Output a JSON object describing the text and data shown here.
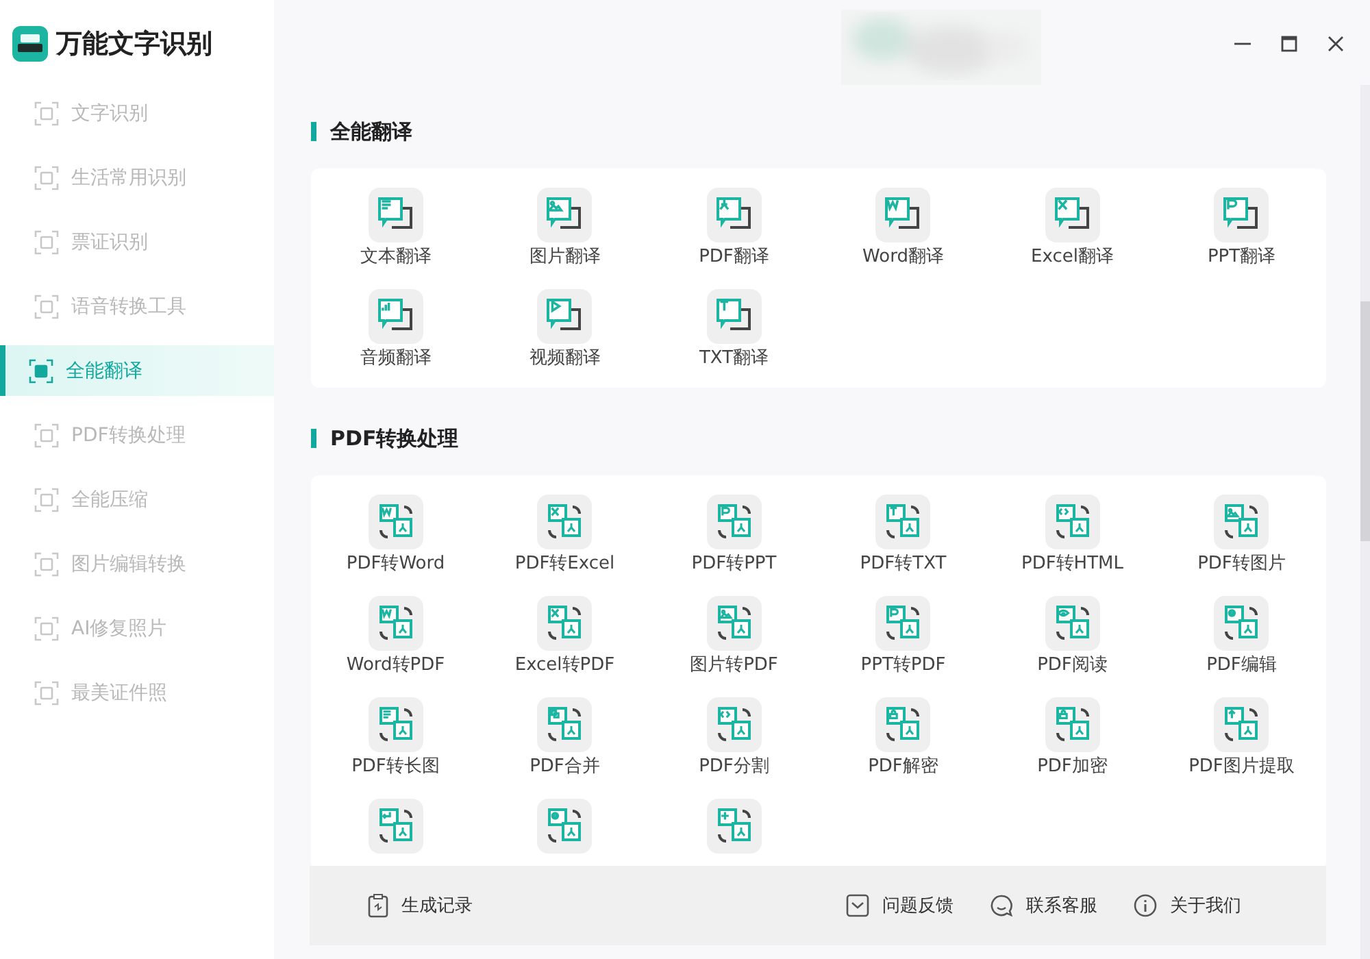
{
  "window": {
    "title": "万能文字识别"
  },
  "sidebar": {
    "items": [
      {
        "label": "文字识别",
        "selected": false
      },
      {
        "label": "生活常用识别",
        "selected": false
      },
      {
        "label": "票证识别",
        "selected": false
      },
      {
        "label": "语音转换工具",
        "selected": false
      },
      {
        "label": "全能翻译",
        "selected": true
      },
      {
        "label": "PDF转换处理",
        "selected": false
      },
      {
        "label": "全能压缩",
        "selected": false
      },
      {
        "label": "图片编辑转换",
        "selected": false
      },
      {
        "label": "AI修复照片",
        "selected": false
      },
      {
        "label": "最美证件照",
        "selected": false
      }
    ]
  },
  "sections": [
    {
      "title": "全能翻译",
      "kind": "translate",
      "items": [
        {
          "label": "文本翻译",
          "kind": "lines"
        },
        {
          "label": "图片翻译"
        },
        {
          "label": "PDF翻译",
          "kind": "pdf"
        },
        {
          "label": "Word翻译",
          "kind": "doc"
        },
        {
          "label": "Excel翻译",
          "kind": "cross"
        },
        {
          "label": "PPT翻译",
          "kind": "slide"
        },
        {
          "label": "音频翻译",
          "kind": "bars"
        },
        {
          "label": "视频翻译",
          "kind": "play"
        },
        {
          "label": "TXT翻译",
          "kind": "tee"
        }
      ]
    },
    {
      "title": "PDF转换处理",
      "kind": "convert",
      "items": [
        {
          "label": "PDF转Word",
          "kind": "doc"
        },
        {
          "label": "PDF转Excel",
          "kind": "cross"
        },
        {
          "label": "PDF转PPT",
          "kind": "slide"
        },
        {
          "label": "PDF转TXT",
          "kind": "tee"
        },
        {
          "label": "PDF转HTML",
          "kind": "code"
        },
        {
          "label": "PDF转图片"
        },
        {
          "label": "Word转PDF",
          "kind": "doc"
        },
        {
          "label": "Excel转PDF",
          "kind": "cross"
        },
        {
          "label": "图片转PDF"
        },
        {
          "label": "PPT转PDF",
          "kind": "slide"
        },
        {
          "label": "PDF阅读",
          "kind": "eye"
        },
        {
          "label": "PDF编辑",
          "kind": "gear"
        },
        {
          "label": "PDF转长图",
          "kind": "lines"
        },
        {
          "label": "PDF合并",
          "kind": "merge"
        },
        {
          "label": "PDF分割",
          "kind": "code"
        },
        {
          "label": "PDF解密",
          "kind": "lock"
        },
        {
          "label": "PDF加密",
          "kind": "lock"
        },
        {
          "label": "PDF图片提取",
          "kind": "up"
        },
        {
          "kind": "enter"
        },
        {
          "kind": "gear"
        },
        {
          "kind": "plus"
        }
      ]
    }
  ],
  "footer": {
    "left": "生成记录",
    "links": [
      {
        "label": "问题反馈",
        "kind": "mail"
      },
      {
        "label": "联系客服",
        "kind": "chat"
      },
      {
        "label": "关于我们",
        "kind": "info"
      }
    ]
  }
}
